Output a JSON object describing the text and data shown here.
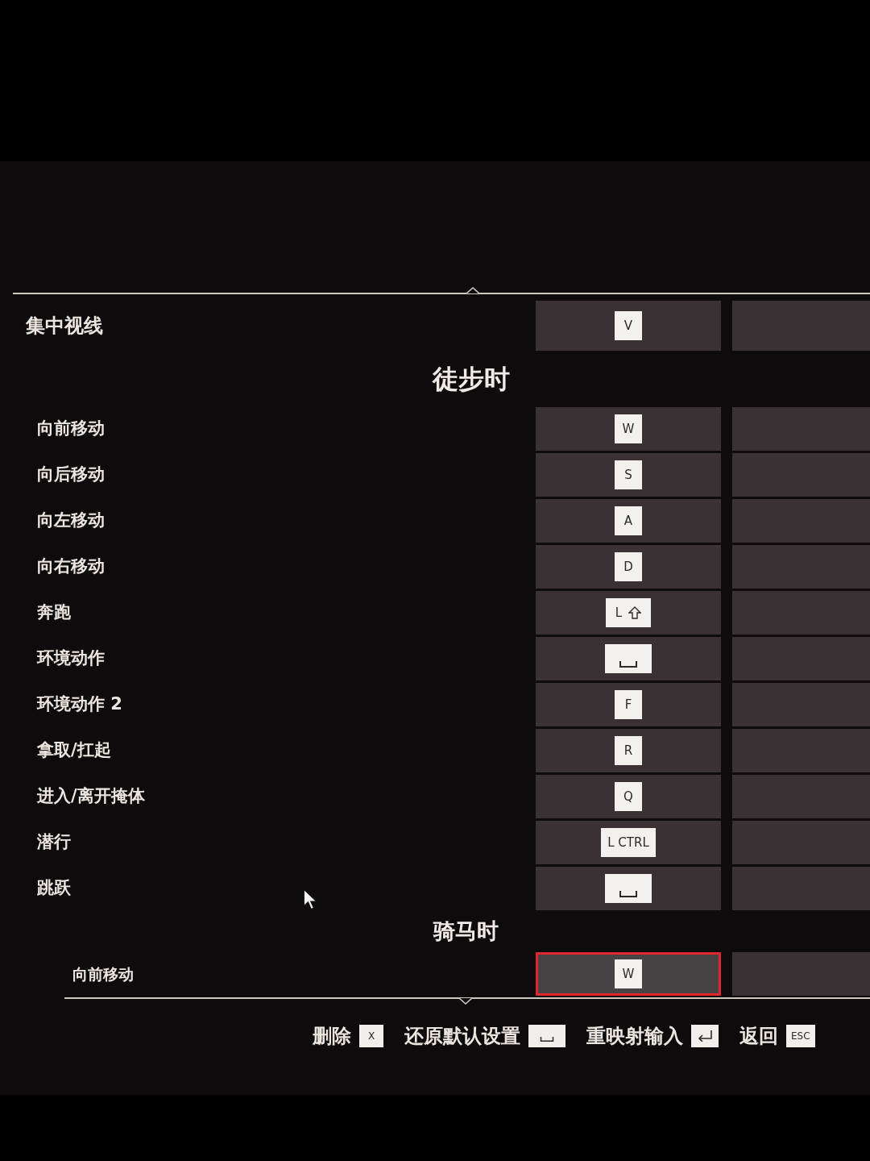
{
  "top_rows": [
    {
      "label": "集中视线",
      "binding": {
        "kind": "text",
        "text": "V"
      },
      "selected": false
    }
  ],
  "sections": [
    {
      "title": "徒步时",
      "rows": [
        {
          "label": "向前移动",
          "binding": {
            "kind": "text",
            "text": "W"
          },
          "selected": false
        },
        {
          "label": "向后移动",
          "binding": {
            "kind": "text",
            "text": "S"
          },
          "selected": false
        },
        {
          "label": "向左移动",
          "binding": {
            "kind": "text",
            "text": "A"
          },
          "selected": false
        },
        {
          "label": "向右移动",
          "binding": {
            "kind": "text",
            "text": "D"
          },
          "selected": false
        },
        {
          "label": "奔跑",
          "binding": {
            "kind": "shift",
            "text": "L"
          },
          "selected": false
        },
        {
          "label": "环境动作",
          "binding": {
            "kind": "space"
          },
          "selected": false
        },
        {
          "label": "环境动作 2",
          "binding": {
            "kind": "text",
            "text": "F"
          },
          "selected": false
        },
        {
          "label": "拿取/扛起",
          "binding": {
            "kind": "text",
            "text": "R"
          },
          "selected": false
        },
        {
          "label": "进入/离开掩体",
          "binding": {
            "kind": "text",
            "text": "Q"
          },
          "selected": false
        },
        {
          "label": "潜行",
          "binding": {
            "kind": "text",
            "text": "L CTRL"
          },
          "selected": false
        },
        {
          "label": "跳跃",
          "binding": {
            "kind": "space"
          },
          "selected": false
        }
      ]
    },
    {
      "title": "骑马时",
      "rows": [
        {
          "label": "向前移动",
          "binding": {
            "kind": "text",
            "text": "W"
          },
          "selected": true
        }
      ]
    }
  ],
  "prompts": [
    {
      "label": "删除",
      "key": {
        "kind": "text",
        "text": "X"
      }
    },
    {
      "label": "还原默认设置",
      "key": {
        "kind": "space"
      }
    },
    {
      "label": "重映射输入",
      "key": {
        "kind": "enter"
      }
    },
    {
      "label": "返回",
      "key": {
        "kind": "text",
        "text": "ESC"
      }
    }
  ]
}
